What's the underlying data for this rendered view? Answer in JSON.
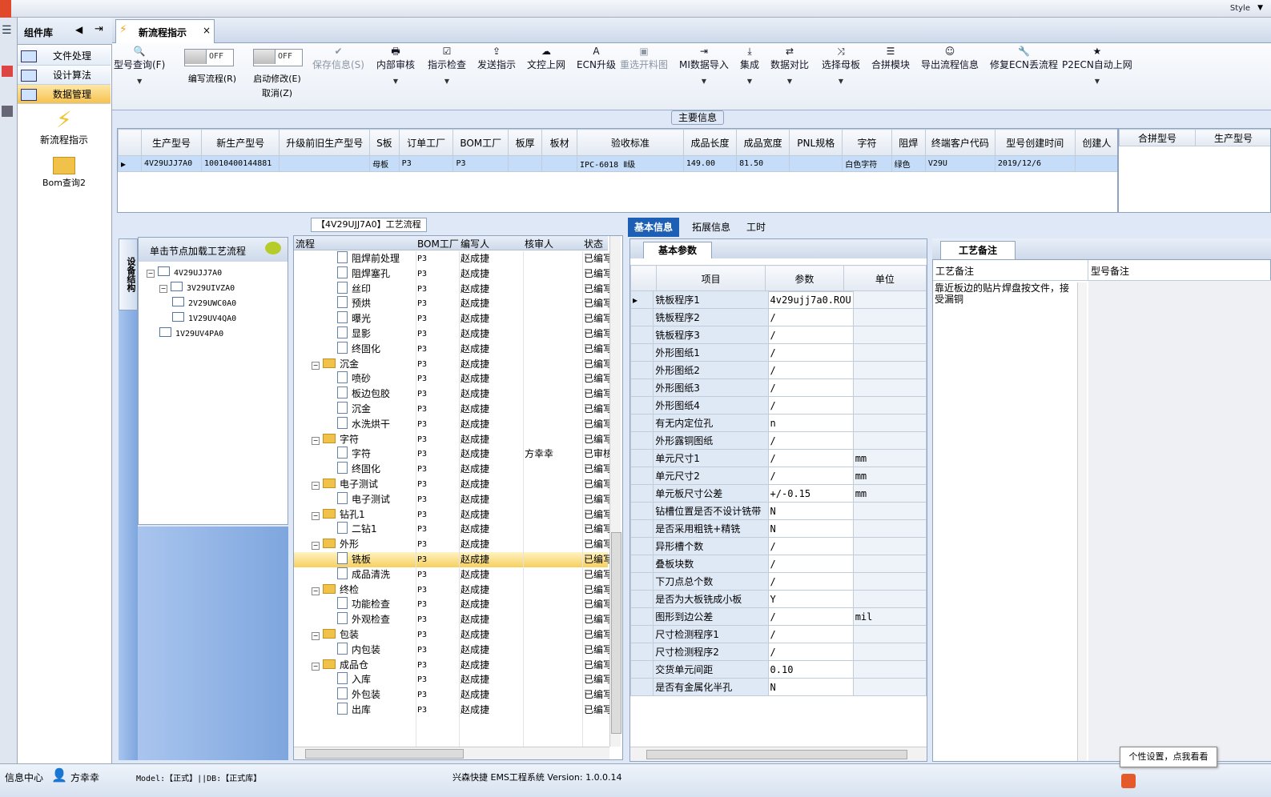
{
  "window": {
    "style_label": "Style"
  },
  "sidebar": {
    "title": "组件库",
    "items": [
      "文件处理",
      "设计算法",
      "数据管理"
    ],
    "active_index": 2,
    "shortcuts": [
      "新流程指示",
      "Bom查询2"
    ]
  },
  "tab": {
    "title": "新流程指示",
    "close": "×"
  },
  "toolbar": {
    "buttons": [
      {
        "label": "型号查询(F)",
        "icon": "🔍",
        "disabled": false,
        "dropdown": true
      },
      {
        "label": "保存信息(S)",
        "icon": "✔",
        "disabled": true,
        "dropdown": false
      },
      {
        "label": "内部审核",
        "icon": "🖶",
        "disabled": false,
        "dropdown": true
      },
      {
        "label": "指示检查",
        "icon": "☑",
        "disabled": false,
        "dropdown": true
      },
      {
        "label": "发送指示",
        "icon": "⇪",
        "disabled": false,
        "dropdown": false
      },
      {
        "label": "文控上网",
        "icon": "☁",
        "disabled": false,
        "dropdown": false
      },
      {
        "label": "ECN升级",
        "icon": "A",
        "disabled": false,
        "dropdown": false
      },
      {
        "label": "重选开料图",
        "icon": "▣",
        "disabled": true,
        "dropdown": false
      },
      {
        "label": "MI数据导入",
        "icon": "⇥",
        "disabled": false,
        "dropdown": true
      },
      {
        "label": "集成",
        "icon": "⤓",
        "disabled": false,
        "dropdown": true
      },
      {
        "label": "数据对比",
        "icon": "⇄",
        "disabled": false,
        "dropdown": true
      },
      {
        "label": "选择母板",
        "icon": "⤨",
        "disabled": false,
        "dropdown": true
      },
      {
        "label": "合拼模块",
        "icon": "☰",
        "disabled": false,
        "dropdown": false
      },
      {
        "label": "导出流程信息",
        "icon": "☺",
        "disabled": false,
        "dropdown": false
      },
      {
        "label": "修复ECN丢流程",
        "icon": "🔧",
        "disabled": false,
        "dropdown": false
      },
      {
        "label": "P2ECN自动上网",
        "icon": "★",
        "disabled": false,
        "dropdown": true
      }
    ],
    "toggle1": {
      "label": "编写流程(R)",
      "state": "OFF"
    },
    "toggle2": {
      "label": "启动修改(E)",
      "sub": "取消(Z)",
      "state": "OFF"
    }
  },
  "main_info": {
    "title": "主要信息",
    "columns": [
      "生产型号",
      "新生产型号",
      "升级前旧生产型号",
      "S板",
      "订单工厂",
      "BOM工厂",
      "板厚",
      "板材",
      "验收标准",
      "成品长度",
      "成品宽度",
      "PNL规格",
      "字符",
      "阻焊",
      "终端客户代码",
      "型号创建时间",
      "创建人"
    ],
    "row": [
      "4V29UJJ7A0",
      "10010400144881",
      "",
      "母板",
      "P3",
      "P3",
      "",
      "",
      "IPC-6018 Ⅱ级",
      "149.00",
      "81.50",
      "",
      "白色字符",
      "绿色",
      "V29U",
      "2019/12/6",
      ""
    ],
    "side_columns": [
      "合拼型号",
      "生产型号"
    ]
  },
  "process": {
    "title": "【4V29UJJ7A0】工艺流程",
    "vtab": "设备结构",
    "hint": "单击节点加载工艺流程",
    "tree": [
      {
        "label": "4V29UJJ7A0",
        "level": 0
      },
      {
        "label": "3V29UIVZA0",
        "level": 1
      },
      {
        "label": "2V29UWC0A0",
        "level": 2
      },
      {
        "label": "1V29UV4QA0",
        "level": 2
      },
      {
        "label": "1V29UV4PA0",
        "level": 1
      }
    ],
    "columns": [
      "流程",
      "BOM工厂",
      "编写人",
      "核审人",
      "状态"
    ],
    "rows": [
      {
        "name": "阻焊前处理",
        "type": "file",
        "factory": "P3",
        "author": "赵成捷",
        "reviewer": "",
        "status": "已编写"
      },
      {
        "name": "阻焊塞孔",
        "type": "file",
        "factory": "P3",
        "author": "赵成捷",
        "reviewer": "",
        "status": "已编写"
      },
      {
        "name": "丝印",
        "type": "file",
        "factory": "P3",
        "author": "赵成捷",
        "reviewer": "",
        "status": "已编写"
      },
      {
        "name": "预烘",
        "type": "file",
        "factory": "P3",
        "author": "赵成捷",
        "reviewer": "",
        "status": "已编写"
      },
      {
        "name": "曝光",
        "type": "file",
        "factory": "P3",
        "author": "赵成捷",
        "reviewer": "",
        "status": "已编写"
      },
      {
        "name": "显影",
        "type": "file",
        "factory": "P3",
        "author": "赵成捷",
        "reviewer": "",
        "status": "已编写"
      },
      {
        "name": "终固化",
        "type": "file",
        "factory": "P3",
        "author": "赵成捷",
        "reviewer": "",
        "status": "已编写"
      },
      {
        "name": "沉金",
        "type": "folder",
        "factory": "P3",
        "author": "赵成捷",
        "reviewer": "",
        "status": "已编写"
      },
      {
        "name": "喷砂",
        "type": "file",
        "factory": "P3",
        "author": "赵成捷",
        "reviewer": "",
        "status": "已编写"
      },
      {
        "name": "板边包胶",
        "type": "file",
        "factory": "P3",
        "author": "赵成捷",
        "reviewer": "",
        "status": "已编写"
      },
      {
        "name": "沉金",
        "type": "file",
        "factory": "P3",
        "author": "赵成捷",
        "reviewer": "",
        "status": "已编写"
      },
      {
        "name": "水洗烘干",
        "type": "file",
        "factory": "P3",
        "author": "赵成捷",
        "reviewer": "",
        "status": "已编写"
      },
      {
        "name": "字符",
        "type": "folder",
        "factory": "P3",
        "author": "赵成捷",
        "reviewer": "",
        "status": "已编写"
      },
      {
        "name": "字符",
        "type": "file",
        "factory": "P3",
        "author": "赵成捷",
        "reviewer": "方幸幸",
        "status": "已审核"
      },
      {
        "name": "终固化",
        "type": "file",
        "factory": "P3",
        "author": "赵成捷",
        "reviewer": "",
        "status": "已编写"
      },
      {
        "name": "电子测试",
        "type": "folder",
        "factory": "P3",
        "author": "赵成捷",
        "reviewer": "",
        "status": "已编写"
      },
      {
        "name": "电子测试",
        "type": "file",
        "factory": "P3",
        "author": "赵成捷",
        "reviewer": "",
        "status": "已编写"
      },
      {
        "name": "钻孔1",
        "type": "folder",
        "factory": "P3",
        "author": "赵成捷",
        "reviewer": "",
        "status": "已编写"
      },
      {
        "name": "二钻1",
        "type": "file",
        "factory": "P3",
        "author": "赵成捷",
        "reviewer": "",
        "status": "已编写"
      },
      {
        "name": "外形",
        "type": "folder",
        "factory": "P3",
        "author": "赵成捷",
        "reviewer": "",
        "status": "已编写"
      },
      {
        "name": "铣板",
        "type": "file",
        "factory": "P3",
        "author": "赵成捷",
        "reviewer": "",
        "status": "已编写",
        "selected": true
      },
      {
        "name": "成品清洗",
        "type": "file",
        "factory": "P3",
        "author": "赵成捷",
        "reviewer": "",
        "status": "已编写"
      },
      {
        "name": "终检",
        "type": "folder",
        "factory": "P3",
        "author": "赵成捷",
        "reviewer": "",
        "status": "已编写"
      },
      {
        "name": "功能检查",
        "type": "file",
        "factory": "P3",
        "author": "赵成捷",
        "reviewer": "",
        "status": "已编写"
      },
      {
        "name": "外观检查",
        "type": "file",
        "factory": "P3",
        "author": "赵成捷",
        "reviewer": "",
        "status": "已编写"
      },
      {
        "name": "包装",
        "type": "folder",
        "factory": "P3",
        "author": "赵成捷",
        "reviewer": "",
        "status": "已编写"
      },
      {
        "name": "内包装",
        "type": "file",
        "factory": "P3",
        "author": "赵成捷",
        "reviewer": "",
        "status": "已编写"
      },
      {
        "name": "成品仓",
        "type": "folder",
        "factory": "P3",
        "author": "赵成捷",
        "reviewer": "",
        "status": "已编写"
      },
      {
        "name": "入库",
        "type": "file",
        "factory": "P3",
        "author": "赵成捷",
        "reviewer": "",
        "status": "已编写"
      },
      {
        "name": "外包装",
        "type": "file",
        "factory": "P3",
        "author": "赵成捷",
        "reviewer": "",
        "status": "已编写"
      },
      {
        "name": "出库",
        "type": "file",
        "factory": "P3",
        "author": "赵成捷",
        "reviewer": "",
        "status": "已编写"
      }
    ]
  },
  "params": {
    "tabs": [
      "基本信息",
      "拓展信息",
      "工时"
    ],
    "subtab": "基本参数",
    "columns": [
      "项目",
      "参数",
      "单位"
    ],
    "rows": [
      [
        "铣板程序1",
        "4v29ujj7a0.ROU",
        ""
      ],
      [
        "铣板程序2",
        "/",
        ""
      ],
      [
        "铣板程序3",
        "/",
        ""
      ],
      [
        "外形图纸1",
        "/",
        ""
      ],
      [
        "外形图纸2",
        "/",
        ""
      ],
      [
        "外形图纸3",
        "/",
        ""
      ],
      [
        "外形图纸4",
        "/",
        ""
      ],
      [
        "有无内定位孔",
        "n",
        ""
      ],
      [
        "外形露铜图纸",
        "/",
        ""
      ],
      [
        "单元尺寸1",
        "/",
        "mm"
      ],
      [
        "单元尺寸2",
        "/",
        "mm"
      ],
      [
        "单元板尺寸公差",
        "+/-0.15",
        "mm"
      ],
      [
        "钻槽位置是否不设计铣带",
        "N",
        ""
      ],
      [
        "是否采用粗铣+精铣",
        "N",
        ""
      ],
      [
        "异形槽个数",
        "/",
        ""
      ],
      [
        "叠板块数",
        "/",
        ""
      ],
      [
        "下刀点总个数",
        "/",
        ""
      ],
      [
        "是否为大板铣成小板",
        "Y",
        ""
      ],
      [
        "图形到边公差",
        "/",
        "mil"
      ],
      [
        "尺寸检测程序1",
        "/",
        ""
      ],
      [
        "尺寸检测程序2",
        "/",
        ""
      ],
      [
        "交货单元间距",
        "0.10",
        ""
      ],
      [
        "是否有金属化半孔",
        "N",
        ""
      ]
    ]
  },
  "notes": {
    "tab": "工艺备注",
    "col1": "工艺备注",
    "col2": "型号备注",
    "text": "靠近板边的贴片焊盘按文件，接受漏铜"
  },
  "status": {
    "center": "信息中心",
    "user": "方幸幸",
    "model": "Model:【正式】||DB:【正式库】",
    "app": "兴森快捷 EMS工程系统 Version: 1.0.0.14",
    "tooltip": "个性设置，点我看看"
  }
}
